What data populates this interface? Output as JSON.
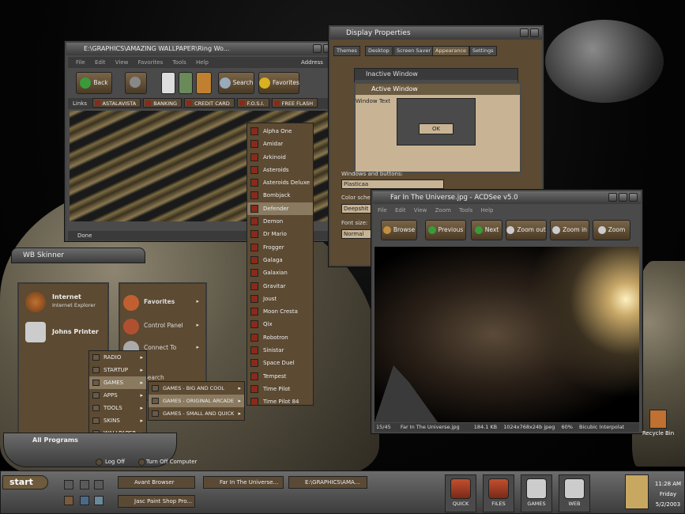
{
  "ie": {
    "title": "E:\\GRAPHICS\\AMAZING WALLPAPER\\Ring Wo...",
    "menu": [
      "File",
      "Edit",
      "View",
      "Favorites",
      "Tools",
      "Help"
    ],
    "address_label": "Address",
    "back": "Back",
    "search": "Search",
    "favorites": "Favorites",
    "links_label": "Links",
    "links": [
      "ASTALAVISTA",
      "BANKING",
      "CREDIT CARD",
      "F.O.S.I.",
      "FREE FLASH"
    ],
    "status": "Done"
  },
  "display": {
    "title": "Display Properties",
    "tabs": [
      "Themes",
      "Desktop",
      "Screen Saver",
      "Appearance",
      "Settings"
    ],
    "inactive": "Inactive Window",
    "active": "Active Window",
    "window_text": "Window Text",
    "ok": "OK",
    "windows_buttons": "Windows and buttons:",
    "style": "Plasticaa",
    "color_scheme": "Color scheme:",
    "scheme_value": "Deepshit",
    "font_size": "Font size:",
    "font_value": "Normal"
  },
  "games_menu": [
    "Alpha One",
    "Amidar",
    "Arkinoid",
    "Asteroids",
    "Asteroids Deluxe",
    "Bombjack",
    "Defender",
    "Demon",
    "Dr Mario",
    "Frogger",
    "Galaga",
    "Galaxian",
    "Gravitar",
    "Joust",
    "Moon Cresta",
    "Qix",
    "Robotron",
    "Sinistar",
    "Space Duel",
    "Tempest",
    "Time Pilot",
    "Time Pilot 84"
  ],
  "acdsee": {
    "title": "Far In The Universe.jpg - ACDSee v5.0",
    "menu": [
      "File",
      "Edit",
      "View",
      "Zoom",
      "Tools",
      "Help"
    ],
    "buttons": [
      "Browse",
      "Previous",
      "Next",
      "Zoom out",
      "Zoom in",
      "Zoom"
    ],
    "status": [
      "15/45",
      "Far In The Universe.jpg",
      "184.1 KB",
      "1024x768x24b jpeg",
      "60%",
      "Bicubic Interpolat"
    ]
  },
  "startmenu": {
    "user": "WB Skinner",
    "internet": "Internet",
    "internet_sub": "Internet Explorer",
    "printer": "Johns Printer",
    "favorites": "Favorites",
    "control_panel": "Control Panel",
    "connect_to": "Connect To",
    "search": "Search",
    "all_programs": "All Programs",
    "log_off": "Log Off",
    "turn_off": "Turn Off Computer"
  },
  "programs_menu": [
    "RADIO",
    "STARTUP",
    "GAMES",
    "APPS",
    "TOOLS",
    "SKINS",
    "WALLPAPER"
  ],
  "games_sub": [
    "GAMES - BIG AND COOL",
    "GAMES - ORIGINAL ARCADE",
    "GAMES - SMALL AND QUICK"
  ],
  "taskbar": {
    "start": "start",
    "tasks": [
      "Avant Browser",
      "Far In The Universe...",
      "E:\\GRAPHICS\\AMA...",
      "Jasc Paint Shop Pro..."
    ],
    "quick": [
      "QUICK",
      "FILES",
      "GAMES",
      "WEB"
    ],
    "time": "11:28 AM",
    "day": "Friday",
    "date": "5/2/2003"
  },
  "desktop": {
    "recycle": "Recycle Bin"
  }
}
